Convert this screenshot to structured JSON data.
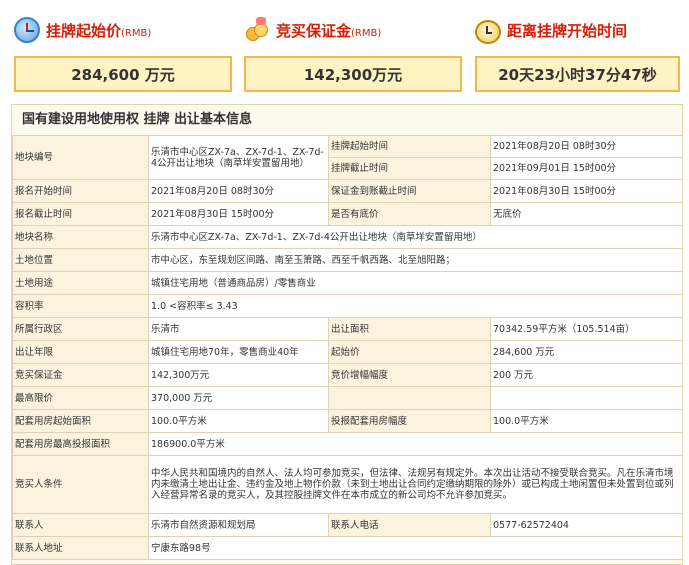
{
  "header": {
    "start_price": {
      "label": "挂牌起始价",
      "unit_tag": "(RMB)",
      "value": "284,600 万元"
    },
    "deposit": {
      "label": "竞买保证金",
      "unit_tag": "(RMB)",
      "value": "142,300万元"
    },
    "countdown": {
      "label": "距离挂牌开始时间",
      "value": "20天23小时37分47秒"
    }
  },
  "section_title": "国有建设用地使用权 挂牌 出让基本信息",
  "rows": [
    {
      "k1": "地块编号",
      "v1": "乐清市中心区ZX-7a、ZX-7d-1、ZX-7d-4公开出让地块（南草垟安置留用地）",
      "k2": "挂牌起始时间",
      "v2": "2021年08月20日 08时30分"
    },
    {
      "k2": "挂牌截止时间",
      "v2": "2021年09月01日 15时00分"
    },
    {
      "k1": "报名开始时间",
      "v1": "2021年08月20日 08时30分",
      "k2": "保证金到账截止时间",
      "v2": "2021年08月30日 15时00分"
    },
    {
      "k1": "报名截止时间",
      "v1": "2021年08月30日 15时00分",
      "k2": "是否有底价",
      "v2": "无底价"
    },
    {
      "k1": "地块名称",
      "v1": "乐清市中心区ZX-7a、ZX-7d-1、ZX-7d-4公开出让地块（南草垟安置留用地）"
    },
    {
      "k1": "土地位置",
      "v1": "市中心区，东至规划区间路、南至玉箫路、西至千帆西路、北至旭阳路；"
    },
    {
      "k1": "土地用途",
      "v1": "城镇住宅用地（普通商品房）/零售商业"
    },
    {
      "k1": "容积率",
      "v1": "1.0 <容积率≤ 3.43"
    },
    {
      "k1": "所属行政区",
      "v1": "乐清市",
      "k2": "出让面积",
      "v2": "70342.59平方米（105.514亩）"
    },
    {
      "k1": "出让年限",
      "v1": "城镇住宅用地70年，零售商业40年",
      "k2": "起始价",
      "v2": "284,600 万元"
    },
    {
      "k1": "竞买保证金",
      "v1": "142,300万元",
      "k2": "竞价增幅幅度",
      "v2": "200 万元"
    },
    {
      "k1": "最高限价",
      "v1": "370,000 万元",
      "k2": "",
      "v2": ""
    },
    {
      "k1": "配套用房起始面积",
      "v1": "100.0平方米",
      "k2": "投报配套用房幅度",
      "v2": "100.0平方米"
    },
    {
      "k1": "配套用房最高投报面积",
      "v1": "186900.0平方米"
    },
    {
      "k1": "竞买人条件",
      "v1": "中华人民共和国境内的自然人、法人均可参加竞买，但法律、法规另有规定外。本次出让活动不接受联合竞买。凡在乐清市境内未缴清土地出让金、违约金及地上物作价款（未到土地出让合同约定缴纳期限的除外）或已构成土地闲置但未处置到位或列入经营异常名录的竞买人，及其控股挂牌文件在本市成立的新公司均不允许参加竞买。"
    },
    {
      "k1": "联系人",
      "v1": "乐清市自然资源和规划局",
      "k2": "联系人电话",
      "v2": "0577-62572404"
    },
    {
      "k1": "联系人地址",
      "v1": "宁康东路98号"
    }
  ]
}
